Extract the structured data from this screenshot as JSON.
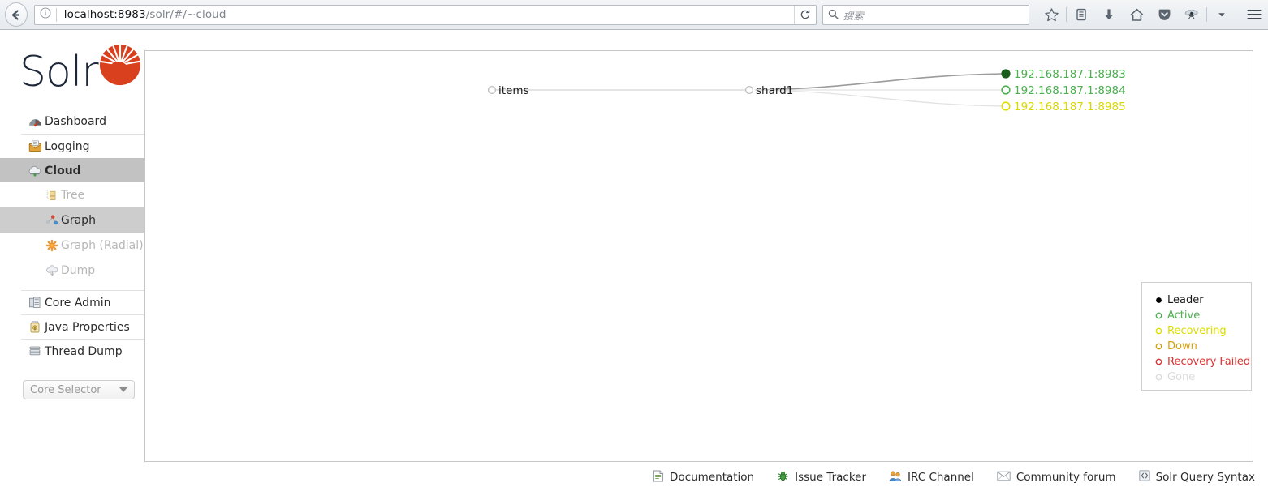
{
  "browser": {
    "back_icon": "back-arrow-icon",
    "site_info_icon": "info-icon",
    "url_host": "localhost:8983",
    "url_path": "/solr/#/~cloud",
    "reload_icon": "reload-icon",
    "search_placeholder": "搜索",
    "search_icon": "search-icon",
    "toolbar_icons": [
      "bookmark-star-icon",
      "library-icon",
      "downloads-icon",
      "home-icon",
      "pocket-icon",
      "addon-fly-icon",
      "overflow-caret-icon",
      "hamburger-menu-icon"
    ]
  },
  "sidebar": {
    "logo_text": "Solr",
    "items": [
      {
        "label": "Dashboard",
        "icon": "dashboard-icon",
        "state": "normal"
      },
      {
        "label": "Logging",
        "icon": "logging-icon",
        "state": "normal"
      },
      {
        "label": "Cloud",
        "icon": "cloud-icon",
        "state": "active"
      }
    ],
    "cloud_subitems": [
      {
        "label": "Tree",
        "icon": "tree-icon",
        "state": "disabled"
      },
      {
        "label": "Graph",
        "icon": "graph-icon",
        "state": "selected"
      },
      {
        "label": "Graph (Radial)",
        "icon": "graph-radial-icon",
        "state": "disabled"
      },
      {
        "label": "Dump",
        "icon": "dump-icon",
        "state": "disabled"
      }
    ],
    "items_bottom": [
      {
        "label": "Core Admin",
        "icon": "core-admin-icon"
      },
      {
        "label": "Java Properties",
        "icon": "java-properties-icon"
      },
      {
        "label": "Thread Dump",
        "icon": "thread-dump-icon"
      }
    ],
    "core_selector": {
      "label": "Core Selector",
      "icon": "chevron-down-icon"
    }
  },
  "graph": {
    "collection": {
      "label": "items",
      "state": "none"
    },
    "shard": {
      "label": "shard1",
      "state": "none"
    },
    "replicas": [
      {
        "label": "192.168.187.1:8983",
        "state": "leader",
        "color": "#2e8b2e"
      },
      {
        "label": "192.168.187.1:8984",
        "state": "active",
        "color": "#4caf50"
      },
      {
        "label": "192.168.187.1:8985",
        "state": "recovering",
        "color": "#d4d400"
      }
    ]
  },
  "legend": {
    "title": "status-legend",
    "entries": [
      {
        "label": "Leader",
        "symbol": "filled",
        "color": "#000000"
      },
      {
        "label": "Active",
        "symbol": "hollow",
        "color": "#4caf50"
      },
      {
        "label": "Recovering",
        "symbol": "hollow",
        "color": "#e0e000"
      },
      {
        "label": "Down",
        "symbol": "hollow",
        "color": "#d9a000"
      },
      {
        "label": "Recovery Failed",
        "symbol": "hollow",
        "color": "#e03030"
      },
      {
        "label": "Gone",
        "symbol": "hollow",
        "color": "#dcdcdc"
      }
    ]
  },
  "footer": {
    "links": [
      {
        "label": "Documentation",
        "icon": "document-icon"
      },
      {
        "label": "Issue Tracker",
        "icon": "bug-icon"
      },
      {
        "label": "IRC Channel",
        "icon": "people-icon"
      },
      {
        "label": "Community forum",
        "icon": "envelope-icon"
      },
      {
        "label": "Solr Query Syntax",
        "icon": "code-icon"
      }
    ]
  },
  "colors": {
    "accent_red": "#d9411e",
    "logo_navy": "#1d2738",
    "sidebar_active": "#c2c2c2",
    "sidebar_selected": "#cdcdcd"
  }
}
